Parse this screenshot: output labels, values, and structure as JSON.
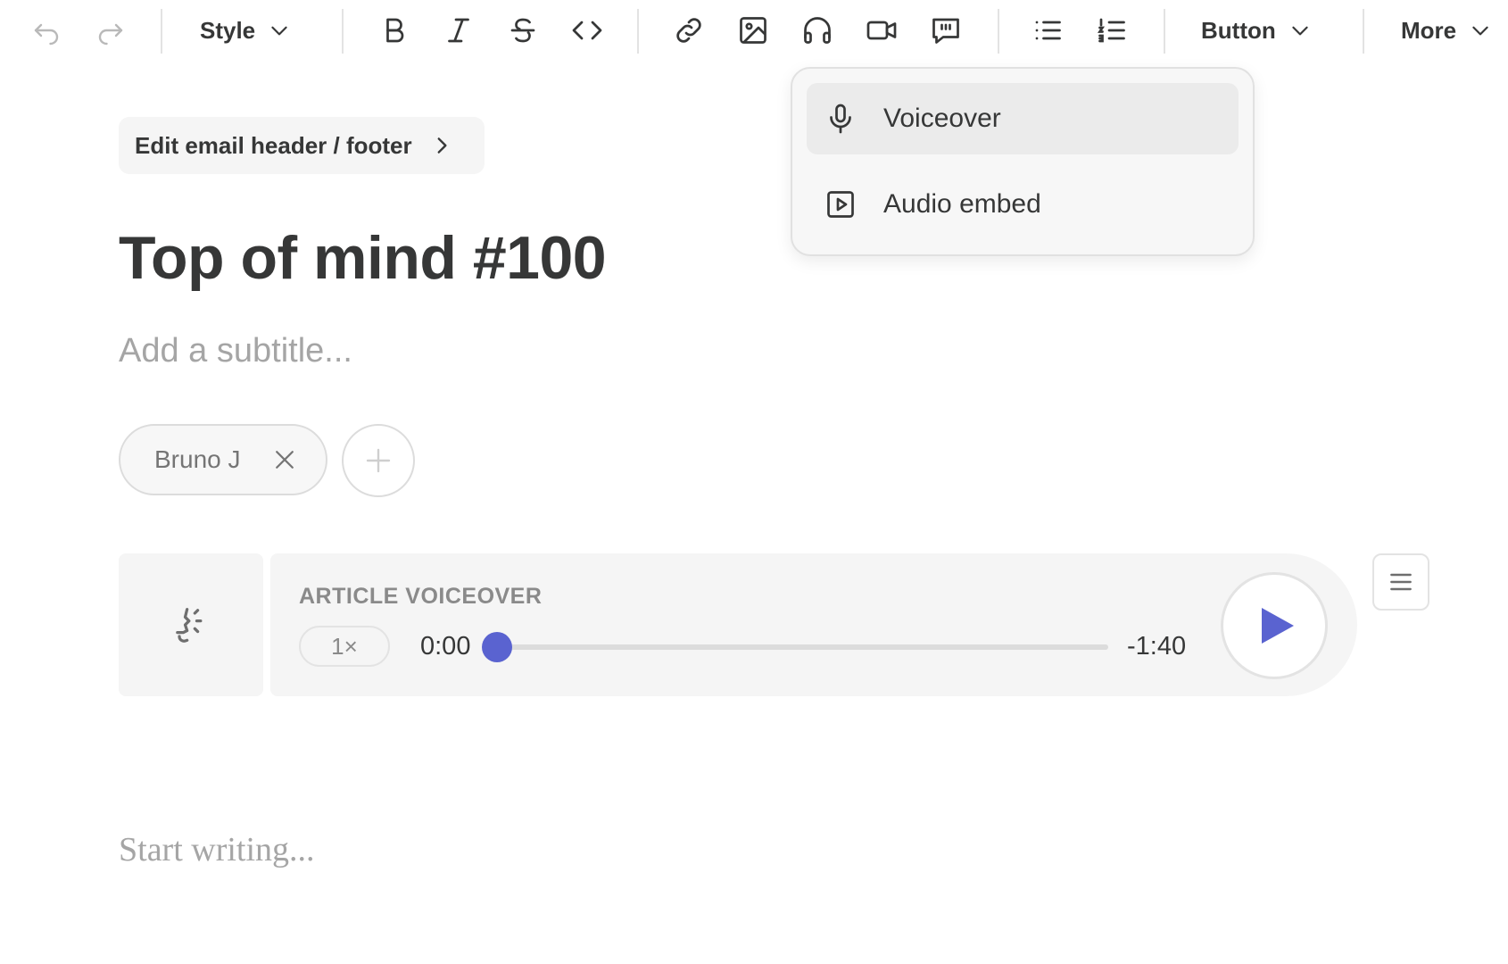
{
  "toolbar": {
    "style_label": "Style",
    "button_label": "Button",
    "more_label": "More",
    "icons": [
      "undo-icon",
      "redo-icon",
      "bold-icon",
      "italic-icon",
      "strikethrough-icon",
      "code-icon",
      "link-icon",
      "image-icon",
      "headphones-icon",
      "video-icon",
      "quote-icon",
      "bulleted-list-icon",
      "numbered-list-icon"
    ]
  },
  "audio_menu": {
    "items": [
      {
        "label": "Voiceover",
        "icon": "microphone-icon",
        "highlighted": true
      },
      {
        "label": "Audio embed",
        "icon": "play-square-icon",
        "highlighted": false
      }
    ]
  },
  "editor": {
    "header_footer_label": "Edit email header / footer",
    "title": "Top of mind #100",
    "subtitle_placeholder": "Add a subtitle...",
    "body_placeholder": "Start writing..."
  },
  "authors": [
    {
      "name": "Bruno J"
    }
  ],
  "voiceover": {
    "label": "ARTICLE VOICEOVER",
    "speed": "1×",
    "current_time": "0:00",
    "remaining_time": "-1:40",
    "progress": 0
  },
  "colors": {
    "accent": "#5a63d0",
    "text": "#363737",
    "muted": "#a5a5a5",
    "surface": "#f5f5f5"
  }
}
